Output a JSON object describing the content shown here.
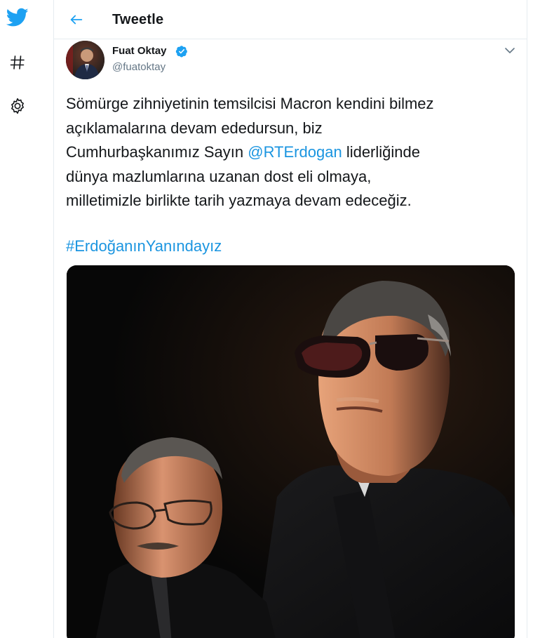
{
  "header": {
    "title": "Tweetle"
  },
  "sidebar": {
    "items": [
      {
        "icon": "twitter-bird-icon"
      },
      {
        "icon": "hashtag-icon"
      },
      {
        "icon": "gear-icon"
      }
    ]
  },
  "tweet": {
    "author": {
      "name": "Fuat Oktay",
      "handle": "@fuatoktay",
      "verified": true
    },
    "lines": [
      "Sömürge zihniyetinin temsilcisi Macron kendini bilmez",
      "açıklamalarına devam ededursun, biz",
      "liderliğinde",
      "dünya mazlumlarına uzanan dost eli olmaya,",
      "milletimizle birlikte tarih yazmaya devam edeceğiz."
    ],
    "line3_prefix": "Cumhurbaşkanımız Sayın ",
    "mention": "@RTErdogan",
    "hashtag": "#ErdoğanınYanındayız"
  },
  "colors": {
    "accent": "#1da1f2",
    "link": "#1b95e0",
    "border": "#e6ecf0",
    "secondary_text": "#657786"
  }
}
